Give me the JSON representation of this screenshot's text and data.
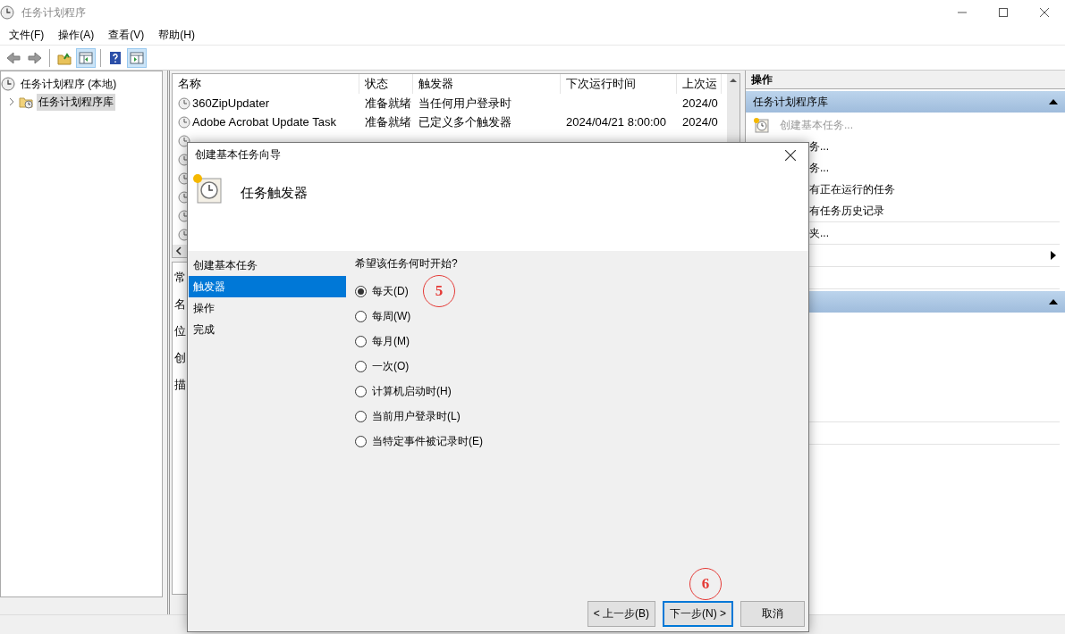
{
  "window": {
    "title": "任务计划程序"
  },
  "menu": [
    "文件(F)",
    "操作(A)",
    "查看(V)",
    "帮助(H)"
  ],
  "toolbar": [
    {
      "kind": "back"
    },
    {
      "kind": "forward"
    },
    {
      "kind": "sep"
    },
    {
      "kind": "folder"
    },
    {
      "kind": "pane-left",
      "selected": true
    },
    {
      "kind": "sep"
    },
    {
      "kind": "help"
    },
    {
      "kind": "pane-right",
      "selected": true
    }
  ],
  "tree": [
    {
      "label": "任务计划程序 (本地)",
      "selected": false,
      "children": [
        {
          "label": "任务计划程序库",
          "selected": true,
          "expanded": false
        }
      ]
    }
  ],
  "table": {
    "columns": [
      "名称",
      "状态",
      "触发器",
      "下次运行时间",
      "上次运"
    ],
    "rows": [
      {
        "cells": [
          "360ZipUpdater",
          "准备就绪",
          "当任何用户登录时",
          "",
          "2024/0"
        ]
      },
      {
        "cells": [
          "Adobe Acrobat Update Task",
          "准备就绪",
          "已定义多个触发器",
          "2024/04/21 8:00:00",
          "2024/0"
        ]
      }
    ]
  },
  "detail": {
    "tab": "常",
    "labels": [
      "名",
      "位",
      "创",
      "描"
    ]
  },
  "actions": {
    "title": "操作",
    "sections": [
      {
        "title": "任务计划程序库",
        "expanded": true,
        "items": [
          {
            "kind": "full",
            "label": "创建基本任务...",
            "disabled": true
          },
          {
            "kind": "cut",
            "label": "务..."
          },
          {
            "kind": "cut",
            "label": "务..."
          },
          {
            "kind": "cut",
            "label": "有正在运行的任务"
          },
          {
            "kind": "cut",
            "label": "有任务历史记录"
          },
          {
            "kind": "separator"
          },
          {
            "kind": "cut",
            "label": "夹..."
          },
          {
            "kind": "separator"
          },
          {
            "kind": "submenu"
          },
          {
            "kind": "separator"
          },
          {
            "kind": "blank"
          },
          {
            "kind": "separator"
          }
        ]
      },
      {
        "expanded": true,
        "items": [
          {
            "kind": "blank"
          },
          {
            "kind": "blank"
          },
          {
            "kind": "blank"
          },
          {
            "kind": "blank"
          },
          {
            "kind": "blank"
          },
          {
            "kind": "separator"
          },
          {
            "kind": "blank"
          },
          {
            "kind": "separator"
          }
        ]
      }
    ]
  },
  "dialog": {
    "title": "创建基本任务向导",
    "heading": "任务触发器",
    "steps": [
      {
        "label": "创建基本任务",
        "selected": false
      },
      {
        "label": "触发器",
        "selected": true
      },
      {
        "label": "操作",
        "selected": false
      },
      {
        "label": "完成",
        "selected": false
      }
    ],
    "question": "希望该任务何时开始?",
    "options": [
      {
        "label": "每天(D)",
        "selected": true
      },
      {
        "label": "每周(W)",
        "selected": false
      },
      {
        "label": "每月(M)",
        "selected": false
      },
      {
        "label": "一次(O)",
        "selected": false
      },
      {
        "label": "计算机启动时(H)",
        "selected": false
      },
      {
        "label": "当前用户登录时(L)",
        "selected": false
      },
      {
        "label": "当特定事件被记录时(E)",
        "selected": false
      }
    ],
    "buttons": [
      {
        "label": "< 上一步(B)",
        "focused": false
      },
      {
        "label": "下一步(N) >",
        "focused": true
      },
      {
        "label": "取消",
        "focused": false
      }
    ]
  },
  "annotations": [
    {
      "text": "5"
    },
    {
      "text": "6"
    }
  ]
}
